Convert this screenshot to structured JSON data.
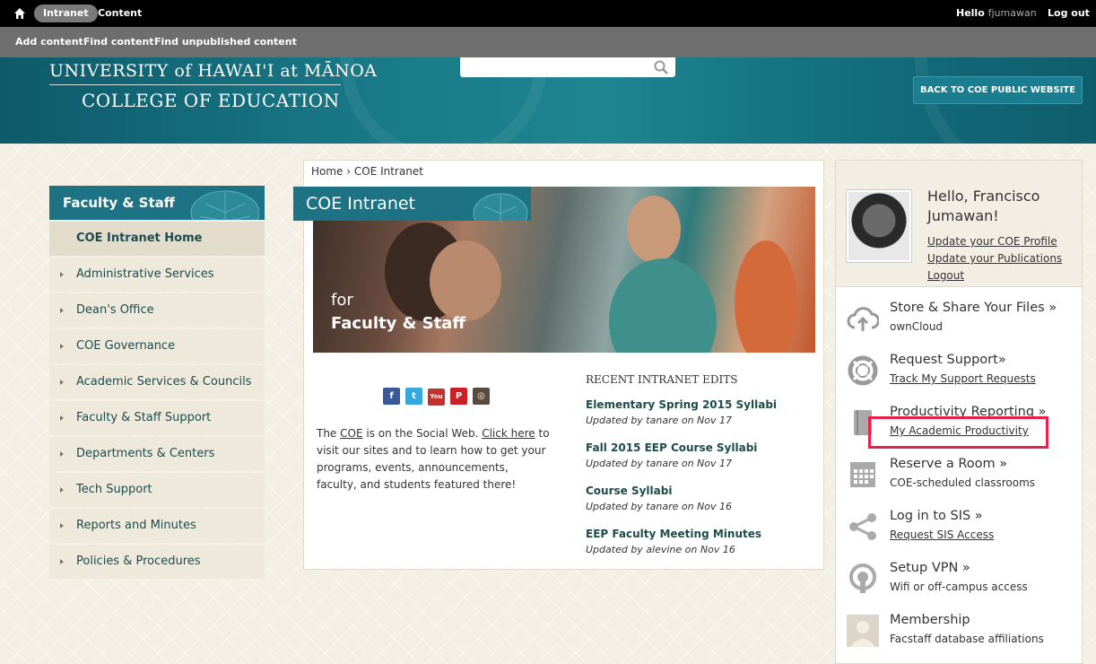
{
  "toolbar": {
    "pill": "Intranet",
    "content": "Content",
    "hello": "Hello",
    "username": "fjumawan",
    "logout": "Log out"
  },
  "shortcuts": {
    "add": "Add content",
    "find": "Find content",
    "unpub": "Find unpublished content"
  },
  "header": {
    "university": "UNIVERSITY of HAWAI'I at MĀNOA",
    "college": "COLLEGE OF EDUCATION",
    "back_button": "BACK TO COE PUBLIC WEBSITE"
  },
  "leftnav": {
    "title": "Faculty & Staff",
    "home": "COE Intranet Home",
    "items": [
      "Administrative Services",
      "Dean's Office",
      "COE Governance",
      "Academic Services & Councils",
      "Faculty & Staff Support",
      "Departments & Centers",
      "Tech Support",
      "Reports and Minutes",
      "Policies & Procedures"
    ]
  },
  "main": {
    "breadcrumb": "Home › COE Intranet",
    "title": "COE Intranet",
    "hero_for": "for",
    "hero_fs": "Faculty & Staff",
    "social_pre": "The ",
    "social_coe": "COE",
    "social_mid": " is on the Social Web. ",
    "social_link": "Click here",
    "social_post": " to visit our sites and to learn how to get your programs, events, announcements, faculty, and students featured there!",
    "recent_head": "RECENT INTRANET EDITS",
    "edits": [
      {
        "title": "Elementary Spring 2015 Syllabi",
        "meta": "Updated by tanare on Nov 17"
      },
      {
        "title": "Fall 2015 EEP Course Syllabi",
        "meta": "Updated by tanare on Nov 17"
      },
      {
        "title": "Course Syllabi",
        "meta": "Updated by tanare on Nov 16"
      },
      {
        "title": "EEP Faculty Meeting Minutes",
        "meta": "Updated by alevine on Nov 16"
      }
    ]
  },
  "profile": {
    "hello": "Hello, Francisco",
    "name": "Jumawan!",
    "link1": "Update your COE Profile",
    "link2": "Update your Publications",
    "logout": "Logout"
  },
  "services": [
    {
      "name": "Store & Share Your Files »",
      "sub": "ownCloud",
      "icon": "cloud-upload-icon"
    },
    {
      "name": "Request Support»",
      "sub": "Track My Support Requests",
      "icon": "lifebuoy-icon"
    },
    {
      "name": "Productivity Reporting »",
      "sub": "My Academic Productivity",
      "icon": "book-icon"
    },
    {
      "name": "Reserve a Room »",
      "sub": "COE-scheduled classrooms",
      "icon": "calendar-icon"
    },
    {
      "name": "Log in to SIS »",
      "sub": "Request SIS Access",
      "icon": "share-nodes-icon"
    },
    {
      "name": "Setup VPN »",
      "sub": "Wifi or off-campus access",
      "icon": "vpn-icon"
    },
    {
      "name": "Membership",
      "sub": "Facstaff database affiliations",
      "icon": "user-placeholder-icon"
    }
  ],
  "colors": {
    "teal": "#1d7383",
    "highlight": "#e8204a"
  }
}
